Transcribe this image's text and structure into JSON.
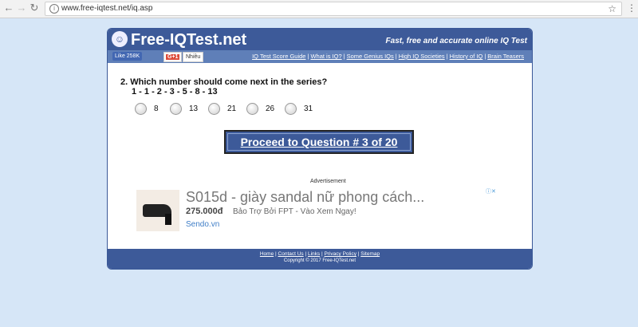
{
  "browser": {
    "url": "www.free-iqtest.net/iq.asp",
    "back_icon": "back-arrow-icon",
    "forward_icon": "forward-arrow-icon",
    "reload_icon": "reload-icon",
    "back_glyph": "←",
    "forward_glyph": "→",
    "reload_glyph": "↻",
    "star_glyph": "☆",
    "menu_glyph": "⋮"
  },
  "site": {
    "logo_text": "Free-IQTest.net",
    "tagline": "Fast, free and accurate online IQ Test",
    "like_label": "Like 258K",
    "gplus_label": "G+1",
    "share_label": "Nhiều",
    "nav": [
      "IQ Test Score Guide",
      "What is IQ?",
      "Some Genius IQs",
      "High IQ Societies",
      "History of IQ",
      "Brain Teasers"
    ],
    "colors": {
      "header": "#3d5a99",
      "subbar": "#5f7fb8",
      "background": "#d6e6f7"
    }
  },
  "question": {
    "title": "2.  Which number should come next in the series?",
    "series": "1 - 1 - 2 - 3 - 5 - 8 - 13",
    "options": [
      "8",
      "13",
      "21",
      "26",
      "31"
    ],
    "proceed_label": "Proceed to Question # 3 of 20"
  },
  "ad": {
    "label": "Advertisement",
    "title": "S015d - giày sandal nữ phong cách...",
    "price": "275.000đ",
    "subtitle": "Bảo Trợ Bởi FPT - Vào Xem Ngay!",
    "site": "Sendo.vn",
    "choices_glyph": "ⓘ✕"
  },
  "footer": {
    "links": [
      "Home",
      "Contact Us",
      "Links",
      "Privacy Policy",
      "Sitemap"
    ],
    "copyright": "Copyright © 2017 Free-IQTest.net"
  }
}
